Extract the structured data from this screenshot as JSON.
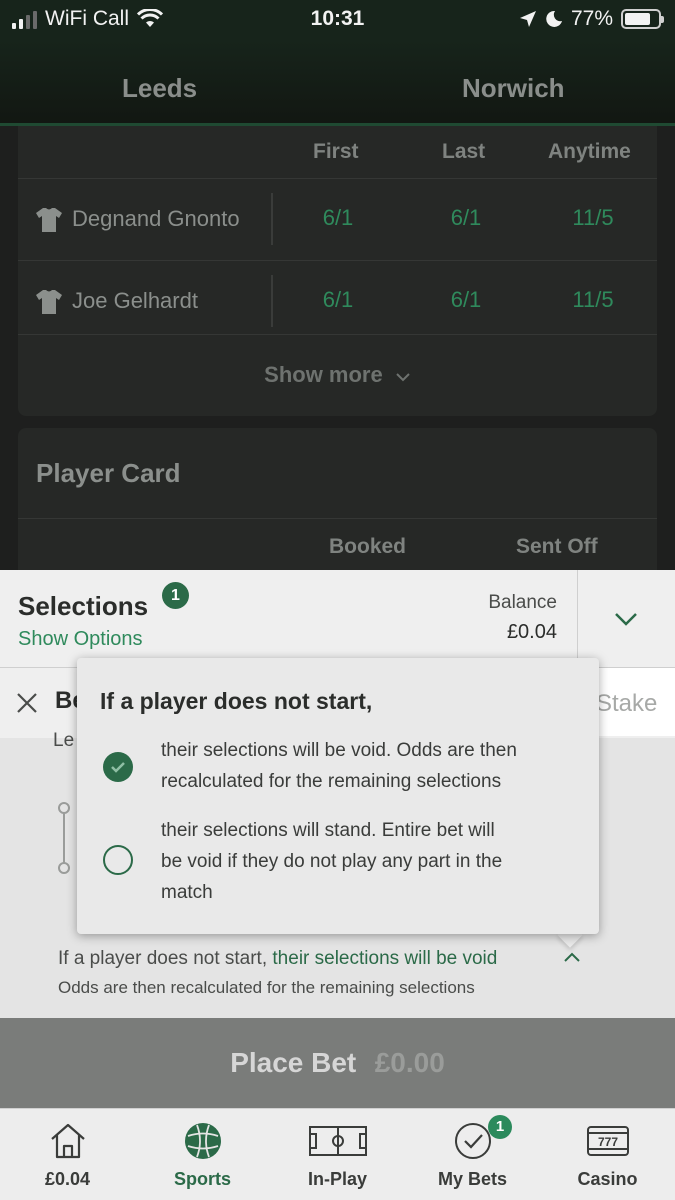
{
  "status_bar": {
    "carrier": "WiFi Call",
    "time": "10:31",
    "battery": "77%",
    "battery_level": 0.77,
    "icons": [
      "signal-icon",
      "wifi-icon",
      "location-icon",
      "moon-icon",
      "battery-icon"
    ]
  },
  "teams": {
    "home": "Leeds",
    "away": "Norwich"
  },
  "scorers": {
    "columns": [
      "First",
      "Last",
      "Anytime"
    ],
    "rows": [
      {
        "name": "Degnand Gnonto",
        "first": "6/1",
        "last": "6/1",
        "anytime": "11/5"
      },
      {
        "name": "Joe Gelhardt",
        "first": "6/1",
        "last": "6/1",
        "anytime": "11/5"
      }
    ],
    "show_more": "Show more"
  },
  "player_card": {
    "title": "Player Card",
    "columns": [
      "Booked",
      "Sent Off"
    ]
  },
  "betslip": {
    "title": "Selections",
    "count": "1",
    "show_options": "Show Options",
    "balance_label": "Balance",
    "balance_value": "£0.04",
    "bet_title": "Be",
    "bet_sub": "Le",
    "stake_placeholder": "Stake",
    "info_prefix": "If a player does not start,",
    "info_link": "their selections will be void",
    "info_line2": "Odds are then recalculated for the remaining selections",
    "place_bet_label": "Place Bet",
    "place_bet_amount": "£0.00"
  },
  "popover": {
    "title": "If a player does not start,",
    "options": [
      {
        "line1": "their selections will be void. Odds are then",
        "line2": "recalculated for the remaining selections",
        "line3": "",
        "selected": true
      },
      {
        "line1": "their selections will stand. Entire bet will",
        "line2": "be void if they do not play any part in the",
        "line3": "match",
        "selected": false
      }
    ]
  },
  "nav": {
    "items": [
      {
        "label": "£0.04",
        "icon": "home-icon"
      },
      {
        "label": "Sports",
        "icon": "football-icon",
        "active": true
      },
      {
        "label": "In-Play",
        "icon": "pitch-icon"
      },
      {
        "label": "My Bets",
        "icon": "check-circle-icon",
        "badge": "1"
      },
      {
        "label": "Casino",
        "icon": "slot-machine-icon"
      }
    ]
  },
  "colors": {
    "odds_green": "#2f8a5c",
    "accent_green": "#2b6a48",
    "dark_bg": "#1e1f1e"
  }
}
